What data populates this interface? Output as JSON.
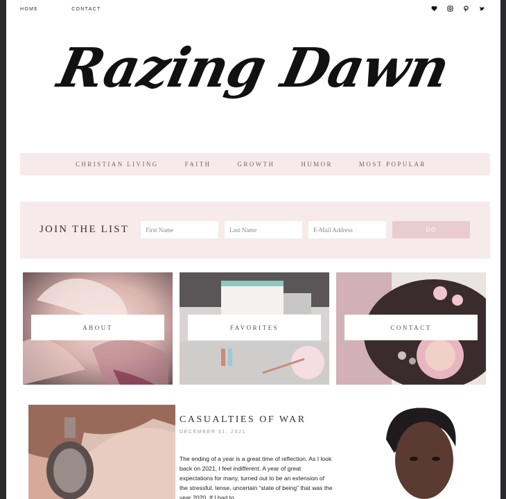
{
  "topnav": {
    "items": [
      "HOME",
      "CONTACT"
    ]
  },
  "social": {
    "icons": [
      "heart-icon",
      "instagram-icon",
      "pinterest-icon",
      "twitter-icon"
    ]
  },
  "logo": {
    "text": "Razing Dawn"
  },
  "categories": [
    "CHRISTIAN LIVING",
    "FAITH",
    "GROWTH",
    "HUMOR",
    "MOST POPULAR"
  ],
  "signup": {
    "title": "JOIN THE LIST",
    "first_name_placeholder": "First Name",
    "last_name_placeholder": "Last Name",
    "email_placeholder": "E-Mail Address",
    "button": "GO"
  },
  "tiles": [
    "ABOUT",
    "FAVORITES",
    "CONTACT"
  ],
  "post": {
    "title": "CASUALTIES OF WAR",
    "date": "DECEMBER 31, 2021",
    "excerpt": "The ending of a year is a great time of reflection. As I look back on 2021, I feel indifferent. A year of great expectations for many, turned out to be an extension of the stressful, tense, uncertain “state of being” that was the year 2020. If I had to"
  },
  "colors": {
    "accent": "#f7eaea",
    "button": "#e8ccd0",
    "frame": "#2b2a2c"
  }
}
